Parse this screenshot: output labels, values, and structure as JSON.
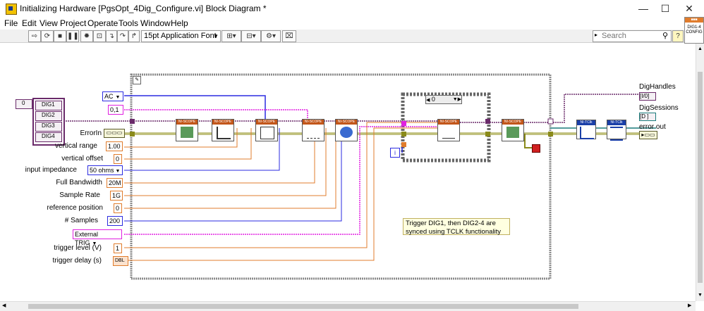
{
  "window": {
    "title": "Initializing Hardware [PgsOpt_4Dig_Configure.vi] Block Diagram *",
    "minimize_glyph": "—",
    "maximize_glyph": "☐",
    "close_glyph": "✕"
  },
  "menu": [
    "File",
    "Edit",
    "View",
    "Project",
    "Operate",
    "Tools",
    "Window",
    "Help"
  ],
  "toolbar": {
    "font": "15pt Application Font",
    "search_placeholder": "Search",
    "connector_label": "DIG1-4 CONFIG"
  },
  "diagram": {
    "index_array": "0",
    "channels": [
      "DIG1",
      "DIG2",
      "DIG3",
      "DIG4"
    ],
    "coupling": "AC",
    "channel_list": "0,1",
    "controls": [
      {
        "label": "ErrorIn",
        "value": ""
      },
      {
        "label": "vertical range",
        "value": "1.00"
      },
      {
        "label": "vertical offset",
        "value": "0"
      },
      {
        "label": "input impedance",
        "value": "50 ohms"
      },
      {
        "label": "Full Bandwidth",
        "value": "20M"
      },
      {
        "label": "Sample Rate",
        "value": "1G"
      },
      {
        "label": "reference position",
        "value": "0"
      },
      {
        "label": "# Samples",
        "value": "200"
      },
      {
        "label": "",
        "value": "External TRIG"
      },
      {
        "label": "trigger level (V)",
        "value": "1"
      },
      {
        "label": "trigger delay (s)",
        "value": "DBL"
      }
    ],
    "case_selector": "0",
    "iteration": "i",
    "subvi_scope": "NI-SCOPE",
    "subvi_tclk": "NI-TClk",
    "comment": "Trigger DIG1, then DIG2-4 are synced using TCLK functionality",
    "outputs": [
      {
        "label": "DigHandles",
        "terminal": "[I/0]"
      },
      {
        "label": "DigSessions",
        "terminal": "[D ]"
      },
      {
        "label": "error out",
        "terminal": ""
      }
    ]
  },
  "colors": {
    "orange_wire": "#e07c2c",
    "blue_wire": "#2b2be0",
    "pink_wire": "#e020e0",
    "error_wire": "#8a8a1a",
    "ref_wire": "#6a2a6a",
    "tclk_wire": "#1a7a7a"
  }
}
